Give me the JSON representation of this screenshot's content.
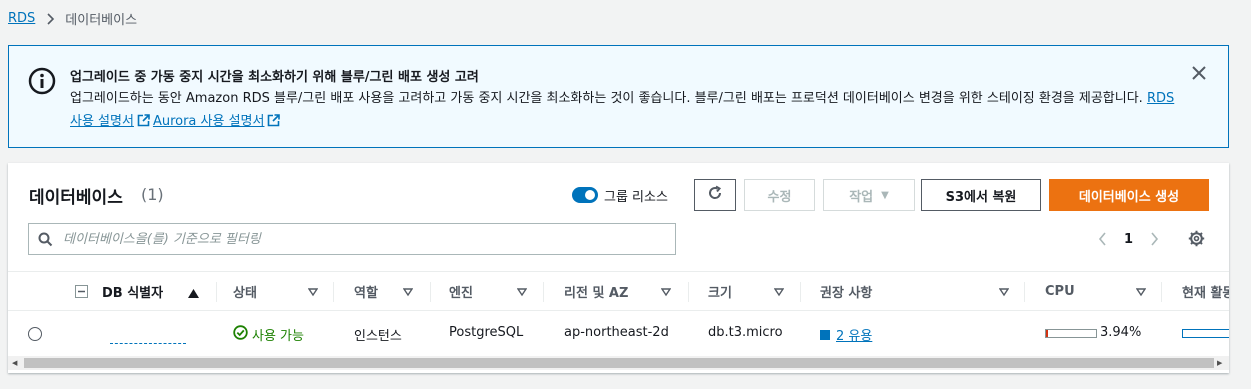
{
  "breadcrumb": {
    "root": "RDS",
    "current": "데이터베이스"
  },
  "flash": {
    "icon": "info-icon",
    "title": "업그레이드 중 가동 중지 시간을 최소화하기 위해 블루/그린 배포 생성 고려",
    "body": "업그레이드하는 동안 Amazon RDS 블루/그린 배포 사용을 고려하고 가동 중지 시간을 최소화하는 것이 좋습니다. 블루/그린 배포는 프로덕션 데이터베이스 변경을 위한 스테이징 환경을 제공합니다.",
    "link_rds": "RDS 사용 설명서",
    "link_aurora": "Aurora 사용 설명서"
  },
  "panel": {
    "title": "데이터베이스",
    "count": "(1)",
    "group_label": "그룹 리소스",
    "buttons": {
      "modify": "수정",
      "actions": "작업",
      "restore": "S3에서 복원",
      "create": "데이터베이스 생성"
    },
    "search_placeholder": "데이터베이스을(를) 기준으로 필터링",
    "page": "1"
  },
  "columns": [
    "DB 식별자",
    "상태",
    "역할",
    "엔진",
    "리전 및 AZ",
    "크기",
    "권장 사항",
    "CPU",
    "현재 활동"
  ],
  "rows": [
    {
      "db_id": "",
      "status": "사용 가능",
      "role": "인스턴스",
      "engine": "PostgreSQL",
      "region": "ap-northeast-2d",
      "size": "db.t3.micro",
      "recommendations": "2 유용",
      "cpu": "3.94%",
      "cpu_fraction": 0.0394
    }
  ],
  "colors": {
    "accent": "#0073bb",
    "primary": "#ec7211",
    "success": "#1d8102"
  }
}
